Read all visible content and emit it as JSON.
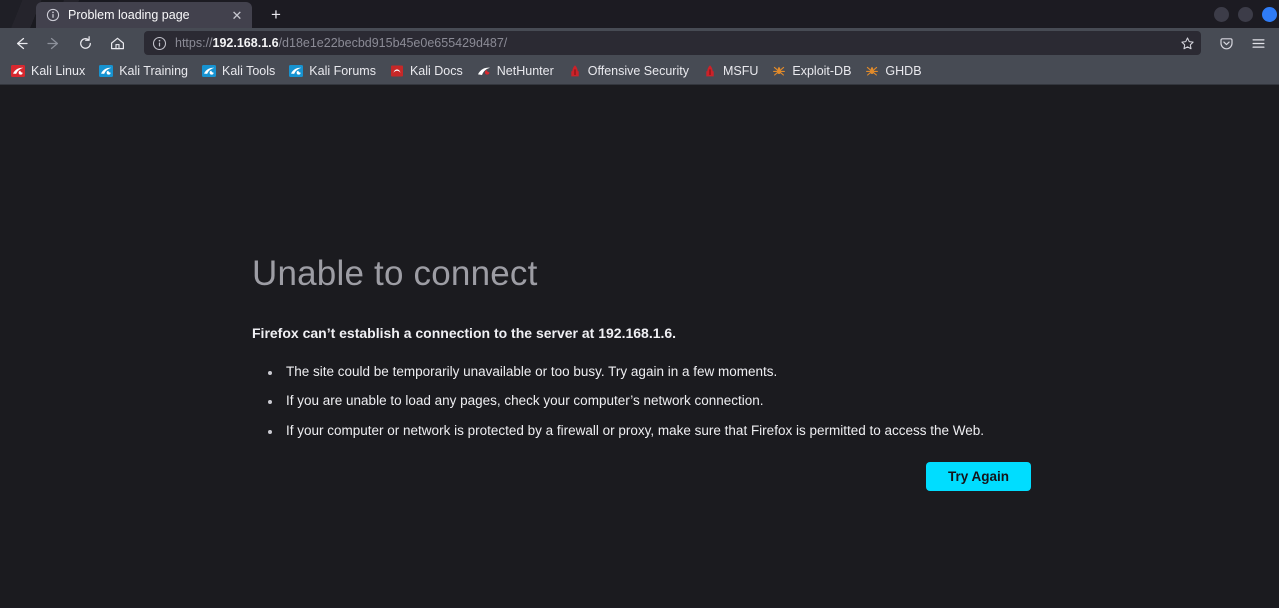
{
  "window": {
    "controls": [
      {
        "name": "minimize",
        "color": "#3c3c48"
      },
      {
        "name": "maximize",
        "color": "#3c3c48"
      },
      {
        "name": "close",
        "color": "#2f7cf6"
      }
    ]
  },
  "tabbar": {
    "tab": {
      "title": "Problem loading page",
      "favicon": "info-circle-icon",
      "close_label": "✕"
    },
    "newtab_label": "+"
  },
  "toolbar": {
    "back": {
      "icon": "back-arrow-icon",
      "label": "←",
      "enabled": true
    },
    "forward": {
      "icon": "forward-arrow-icon",
      "label": "→",
      "enabled": false
    },
    "reload": {
      "icon": "reload-icon"
    },
    "home": {
      "icon": "home-icon"
    },
    "pocket": {
      "icon": "pocket-icon"
    },
    "menu": {
      "icon": "hamburger-menu-icon"
    }
  },
  "urlbar": {
    "identity_icon": "info-circle-icon",
    "scheme": "https://",
    "host": "192.168.1.6",
    "path": "/d18e1e22becbd915b45e0e655429d487/",
    "full_url": "https://192.168.1.6/d18e1e22becbd915b45e0e655429d487/",
    "bookmark_icon": "star-icon"
  },
  "bookmarks": [
    {
      "label": "Kali Linux",
      "icon": "kali-dragon-icon",
      "color": "#d7282f"
    },
    {
      "label": "Kali Training",
      "icon": "kali-dragon-icon",
      "color": "#1793d1"
    },
    {
      "label": "Kali Tools",
      "icon": "kali-dragon-icon",
      "color": "#1793d1"
    },
    {
      "label": "Kali Forums",
      "icon": "kali-dragon-icon",
      "color": "#1793d1"
    },
    {
      "label": "Kali Docs",
      "icon": "kali-docs-icon",
      "color": "#c62828"
    },
    {
      "label": "NetHunter",
      "icon": "kali-dragon-icon",
      "color": "#ffffff"
    },
    {
      "label": "Offensive Security",
      "icon": "offsec-icon",
      "color": "#cc2229"
    },
    {
      "label": "MSFU",
      "icon": "offsec-icon",
      "color": "#cc2229"
    },
    {
      "label": "Exploit-DB",
      "icon": "spider-icon",
      "color": "#e08a2b"
    },
    {
      "label": "GHDB",
      "icon": "spider-icon",
      "color": "#e08a2b"
    }
  ],
  "error_page": {
    "title": "Unable to connect",
    "lead": "Firefox can’t establish a connection to the server at 192.168.1.6.",
    "bullets": [
      "The site could be temporarily unavailable or too busy. Try again in a few moments.",
      "If you are unable to load any pages, check your computer’s network connection.",
      "If your computer or network is protected by a firewall or proxy, make sure that Firefox is permitted to access the Web."
    ],
    "retry_label": "Try Again",
    "accent_color": "#00ddff"
  }
}
